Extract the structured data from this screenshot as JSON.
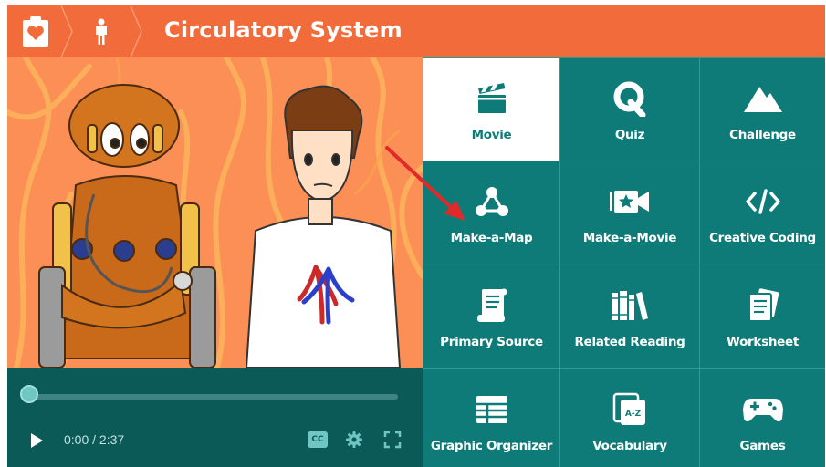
{
  "header": {
    "title": "Circulatory System",
    "home_icon": "heart-clipboard-icon",
    "topic_icon": "person-icon"
  },
  "video": {
    "current_time": "0:00",
    "separator": " / ",
    "duration": "2:37",
    "progress": 0.02,
    "cc_label": "CC",
    "icons": [
      "play-icon",
      "closed-captions-icon",
      "gear-icon",
      "fullscreen-icon"
    ]
  },
  "tiles": [
    {
      "label": "Movie",
      "icon": "clapperboard-icon",
      "active": true
    },
    {
      "label": "Quiz",
      "icon": "quiz-q-icon"
    },
    {
      "label": "Challenge",
      "icon": "mountain-icon"
    },
    {
      "label": "Make-a-Map",
      "icon": "concept-map-icon"
    },
    {
      "label": "Make-a-Movie",
      "icon": "video-camera-star-icon"
    },
    {
      "label": "Creative Coding",
      "icon": "code-brackets-icon"
    },
    {
      "label": "Primary Source",
      "icon": "scroll-icon"
    },
    {
      "label": "Related Reading",
      "icon": "books-icon"
    },
    {
      "label": "Worksheet",
      "icon": "worksheet-icon"
    },
    {
      "label": "Graphic Organizer",
      "icon": "table-grid-icon"
    },
    {
      "label": "Vocabulary",
      "icon": "a-z-cards-icon"
    },
    {
      "label": "Games",
      "icon": "gamepad-icon"
    }
  ],
  "colors": {
    "header": "#f26b3a",
    "teal": "#0f7b78",
    "video_bg": "#fb8f55",
    "annotation_arrow": "#e02a2a"
  }
}
